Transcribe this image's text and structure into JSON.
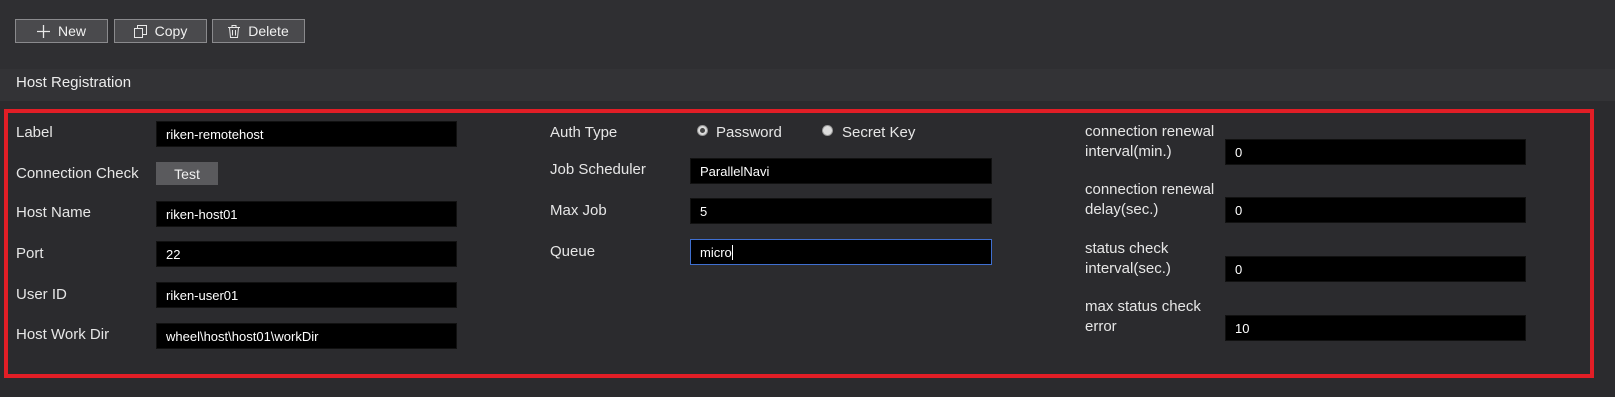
{
  "toolbar": {
    "new_label": "New",
    "copy_label": "Copy",
    "delete_label": "Delete"
  },
  "section_title": "Host Registration",
  "form": {
    "label": {
      "label": "Label",
      "value": "riken-remotehost"
    },
    "connection_check": {
      "label": "Connection Check",
      "button": "Test"
    },
    "host_name": {
      "label": "Host Name",
      "value": "riken-host01"
    },
    "port": {
      "label": "Port",
      "value": "22"
    },
    "user_id": {
      "label": "User ID",
      "value": "riken-user01"
    },
    "host_work_dir": {
      "label": "Host Work Dir",
      "value": "wheel\\host\\host01\\workDir"
    },
    "auth_type": {
      "label": "Auth Type",
      "options": [
        "Password",
        "Secret Key"
      ],
      "selected": "Password"
    },
    "job_scheduler": {
      "label": "Job Scheduler",
      "value": "ParallelNavi"
    },
    "max_job": {
      "label": "Max Job",
      "value": "5"
    },
    "queue": {
      "label": "Queue",
      "value": "micro"
    },
    "renewal_interval": {
      "label_line1": "connection renewal",
      "label_line2": "interval(min.)",
      "value": "0"
    },
    "renewal_delay": {
      "label_line1": "connection renewal",
      "label_line2": "delay(sec.)",
      "value": "0"
    },
    "status_interval": {
      "label_line1": "status check",
      "label_line2": "interval(sec.)",
      "value": "0"
    },
    "max_status_error": {
      "label_line1": "max status check",
      "label_line2": "error",
      "value": "10"
    }
  },
  "colors": {
    "highlight_border": "#e11e26",
    "background": "#2b2b2e",
    "input_bg": "#000000"
  },
  "icons": {
    "new": "plus-icon",
    "copy": "copy-icon",
    "delete": "trash-icon"
  }
}
